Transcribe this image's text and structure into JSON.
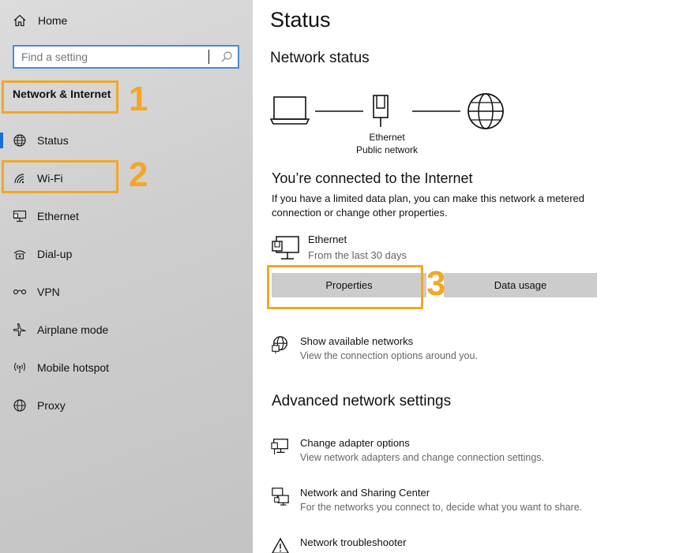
{
  "sidebar": {
    "home_label": "Home",
    "search_placeholder": "Find a setting",
    "section_title": "Network & Internet",
    "items": [
      {
        "label": "Status",
        "icon": "globe-status-icon",
        "selected": true
      },
      {
        "label": "Wi-Fi",
        "icon": "wifi-icon"
      },
      {
        "label": "Ethernet",
        "icon": "ethernet-icon"
      },
      {
        "label": "Dial-up",
        "icon": "dialup-icon"
      },
      {
        "label": "VPN",
        "icon": "vpn-icon"
      },
      {
        "label": "Airplane mode",
        "icon": "airplane-icon"
      },
      {
        "label": "Mobile hotspot",
        "icon": "hotspot-icon"
      },
      {
        "label": "Proxy",
        "icon": "globe-icon"
      }
    ]
  },
  "annotations": {
    "one": "1",
    "two": "2",
    "three": "3",
    "color": "#f5a623"
  },
  "main": {
    "page_title": "Status",
    "network_status_heading": "Network status",
    "diagram": {
      "adapter_name": "Ethernet",
      "network_type": "Public network"
    },
    "connected_title": "You’re connected to the Internet",
    "connected_desc": "If you have a limited data plan, you can make this network a metered connection or change other properties.",
    "connection": {
      "name": "Ethernet",
      "subtitle": "From the last 30 days"
    },
    "buttons": {
      "properties": "Properties",
      "data_usage": "Data usage"
    },
    "show_networks": {
      "title": "Show available networks",
      "desc": "View the connection options around you."
    },
    "advanced_heading": "Advanced network settings",
    "advanced_items": [
      {
        "title": "Change adapter options",
        "desc": "View network adapters and change connection settings.",
        "icon": "adapter-icon"
      },
      {
        "title": "Network and Sharing Center",
        "desc": "For the networks you connect to, decide what you want to share.",
        "icon": "sharing-center-icon"
      },
      {
        "title": "Network troubleshooter",
        "icon": "warning-icon"
      }
    ]
  },
  "colors": {
    "accent": "#1a6fd1",
    "search_border": "#4a8bd2",
    "button_bg": "#cccccc"
  }
}
